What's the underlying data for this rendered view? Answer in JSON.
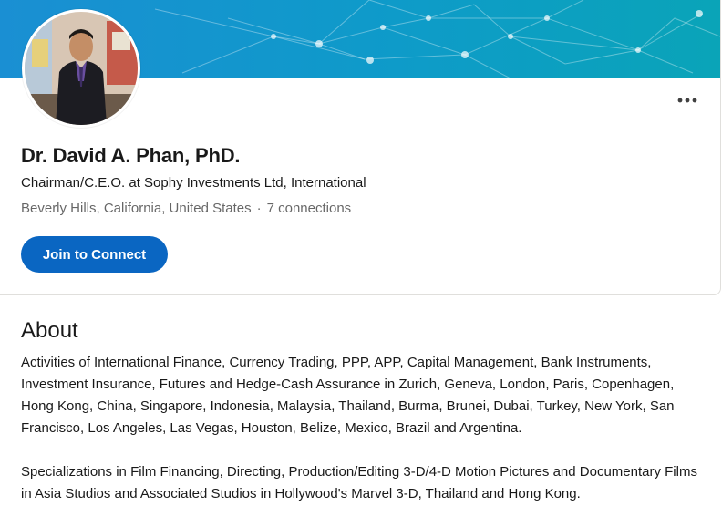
{
  "profile": {
    "name": "Dr. David A. Phan, PhD.",
    "headline": "Chairman/C.E.O. at Sophy Investments Ltd, International",
    "location": "Beverly Hills, California, United States",
    "separator": "·",
    "connections": "7 connections",
    "connect_label": "Join to Connect",
    "more_icon": "more-horizontal-icon"
  },
  "about": {
    "title": "About",
    "paragraphs": [
      "Activities of International Finance, Currency Trading, PPP, APP, Capital Management, Bank Instruments, Investment Insurance, Futures and Hedge-Cash Assurance in Zurich, Geneva, London, Paris, Copenhagen, Hong Kong, China, Singapore, Indonesia, Malaysia, Thailand, Burma, Brunei, Dubai, Turkey, New York, San Francisco, Los Angeles, Las Vegas, Houston, Belize, Mexico, Brazil and Argentina.",
      "Specializations in Film Financing, Directing, Production/Editing 3-D/4-D Motion Pictures and Documentary Films in Asia Studios and Associated Studios in Hollywood's Marvel 3-D, Thailand and Hong Kong."
    ]
  },
  "colors": {
    "accent": "#0a66c2",
    "banner_start": "#1a8fd3",
    "banner_end": "#0aa4b8"
  }
}
